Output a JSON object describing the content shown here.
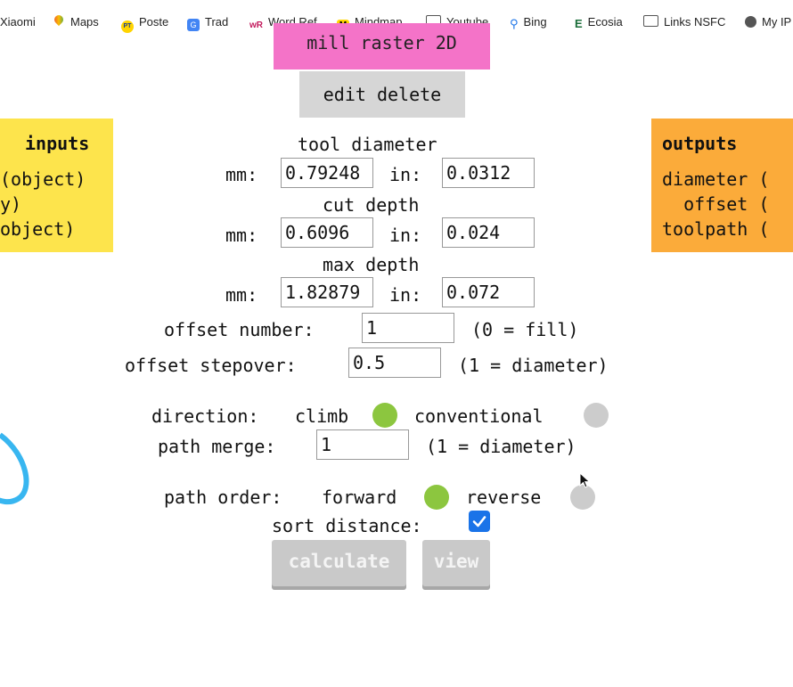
{
  "bookmarks": [
    {
      "label": "Xiaomi",
      "icon": "none"
    },
    {
      "label": "Maps",
      "icon": "maps-pin-icon"
    },
    {
      "label": "Poste",
      "icon": "poste-pt-icon"
    },
    {
      "label": "Trad",
      "icon": "translate-icon"
    },
    {
      "label": "Word Ref",
      "icon": "wordref-icon"
    },
    {
      "label": "Mindmap",
      "icon": "mindmap-icon"
    },
    {
      "label": "Youtube",
      "icon": "folder-icon"
    },
    {
      "label": "Bing",
      "icon": "search-icon"
    },
    {
      "label": "Ecosia",
      "icon": "ecosia-icon"
    },
    {
      "label": "Links NSFC",
      "icon": "folder-icon"
    },
    {
      "label": "My IP",
      "icon": "globe-icon"
    }
  ],
  "bookmark_glyphs": {
    "poste": "PT",
    "trad": "G",
    "wordref": "wR",
    "mindmap": "M",
    "ecosia": "E",
    "bing": "⚲"
  },
  "node": {
    "title": "mill raster 2D",
    "edit_label": "edit delete"
  },
  "inputs_panel": {
    "title": "inputs",
    "lines": [
      "(object)",
      "y)",
      "object)"
    ]
  },
  "outputs_panel": {
    "title": "outputs",
    "lines": [
      "diameter (",
      "  offset (",
      "toolpath ("
    ]
  },
  "form": {
    "tool_diameter": {
      "label": "tool diameter",
      "mm_label": "mm:",
      "in_label": "in:",
      "mm": "0.79248",
      "in": "0.0312"
    },
    "cut_depth": {
      "label": "cut depth",
      "mm_label": "mm:",
      "in_label": "in:",
      "mm": "0.6096",
      "in": "0.024"
    },
    "max_depth": {
      "label": "max depth",
      "mm_label": "mm:",
      "in_label": "in:",
      "mm": "1.82879",
      "in": "0.072"
    },
    "offset_number": {
      "label": "offset number:",
      "value": "1",
      "hint": "(0 = fill)"
    },
    "offset_stepover": {
      "label": "offset stepover:",
      "value": "0.5",
      "hint": "(1 = diameter)"
    },
    "direction": {
      "label": "direction:",
      "option_a": "climb",
      "option_b": "conventional",
      "selected": "climb"
    },
    "path_merge": {
      "label": "path merge:",
      "value": "1",
      "hint": "(1 = diameter)"
    },
    "path_order": {
      "label": "path order:",
      "option_a": "forward",
      "option_b": "reverse",
      "selected": "forward"
    },
    "sort_distance": {
      "label": "sort distance:",
      "checked": true
    },
    "calculate_label": "calculate",
    "view_label": "view"
  },
  "colors": {
    "node_title_bg": "#f473c8",
    "inputs_bg": "#fde44c",
    "outputs_bg": "#fbab3a",
    "radio_on": "#8cc63f",
    "radio_off": "#cccccc",
    "checkbox": "#1a73e8",
    "wire": "#38b6f0"
  }
}
